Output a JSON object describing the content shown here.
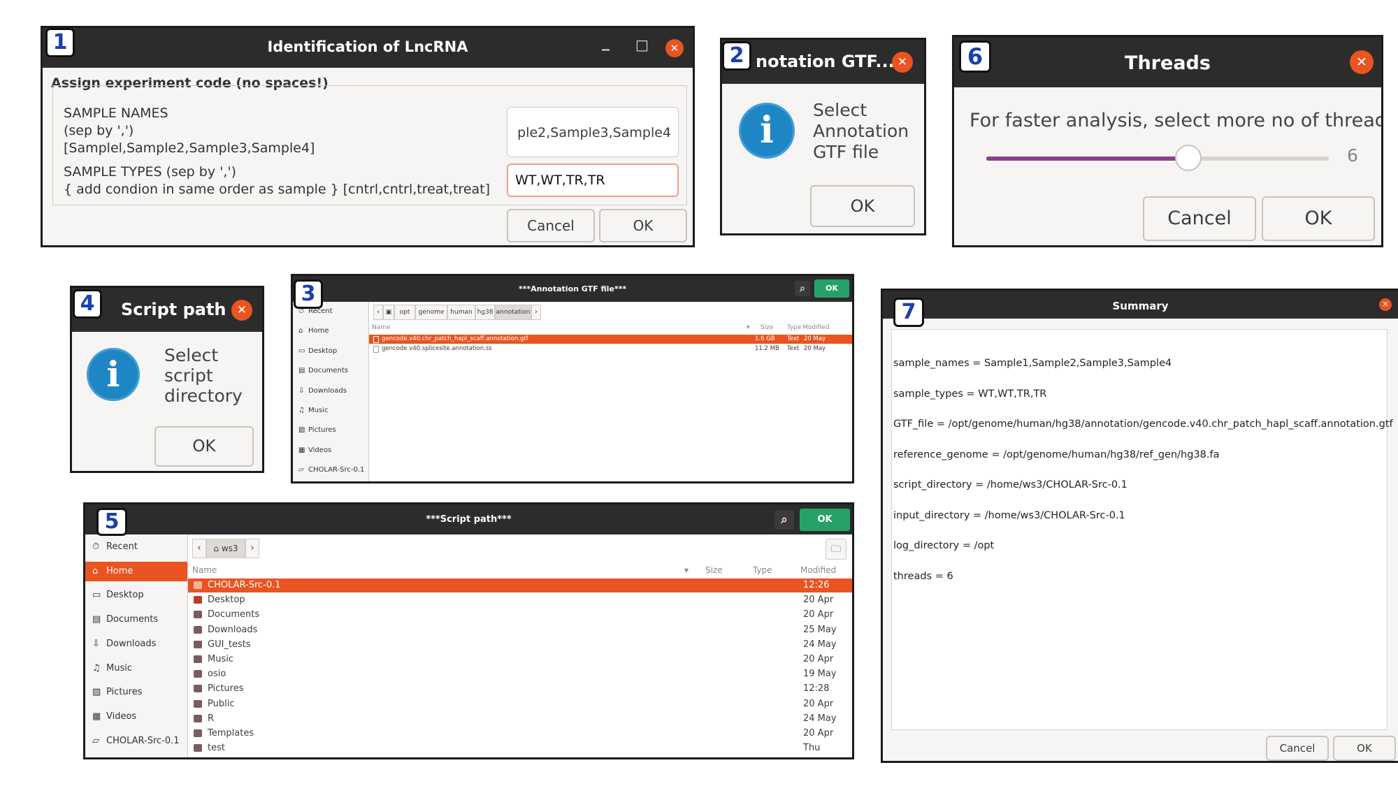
{
  "dialog1": {
    "number": "1",
    "title": "Identification of LncRNA",
    "minimize_icon": "minimize-icon",
    "maximize_icon": "maximize-icon",
    "close_icon": "close-icon",
    "close_glyph": "✕",
    "minimize_glyph": "_",
    "maximize_glyph": "□",
    "group_label": "Assign experiment code (no spaces!)",
    "names_label": [
      "SAMPLE NAMES",
      "(sep by ',')",
      "[Samplel,Sample2,Sample3,Sample4]"
    ],
    "names_value": "ple2,Sample3,Sample4",
    "types_label": [
      "SAMPLE TYPES (sep by ',')",
      "{ add condion in same order as sample } [cntrl,cntrl,treat,treat]"
    ],
    "types_value": "WT,WT,TR,TR",
    "cancel": "Cancel",
    "ok": "OK"
  },
  "dialog2": {
    "number": "2",
    "title": "notation GTF...",
    "close_glyph": "✕",
    "info_glyph": "i",
    "message": [
      "Select",
      "Annotation",
      "GTF file"
    ],
    "ok": "OK"
  },
  "dialog6": {
    "number": "6",
    "title": "Threads",
    "close_glyph": "✕",
    "message": "For faster analysis, select more no of threads",
    "slider_value": "6",
    "slider_fraction": 0.59,
    "cancel": "Cancel",
    "ok": "OK"
  },
  "dialog4": {
    "number": "4",
    "title": "Script path",
    "close_glyph": "✕",
    "info_glyph": "i",
    "message": [
      "Select",
      "script",
      "directory"
    ],
    "ok": "OK"
  },
  "dialog3": {
    "number": "3",
    "title": "***Annotation GTF file***",
    "ok": "OK",
    "search_glyph": "⌕",
    "sidebar": [
      {
        "label": "Recent",
        "icon": "clock-icon",
        "glyph": "⏱"
      },
      {
        "label": "Home",
        "icon": "home-icon",
        "glyph": "⌂"
      },
      {
        "label": "Desktop",
        "icon": "desktop-icon",
        "glyph": "▭"
      },
      {
        "label": "Documents",
        "icon": "document-icon",
        "glyph": "▤"
      },
      {
        "label": "Downloads",
        "icon": "download-icon",
        "glyph": "⇩"
      },
      {
        "label": "Music",
        "icon": "music-icon",
        "glyph": "♫"
      },
      {
        "label": "Pictures",
        "icon": "picture-icon",
        "glyph": "▨"
      },
      {
        "label": "Videos",
        "icon": "video-icon",
        "glyph": "▦"
      },
      {
        "label": "CHOLAR-Src-0.1",
        "icon": "folder-icon",
        "glyph": "▱"
      }
    ],
    "path": [
      "opt",
      "genome",
      "human",
      "hg38",
      "annotation"
    ],
    "columns": {
      "name": "Name",
      "size": "Size",
      "type": "Type",
      "modified": "Modified"
    },
    "files": [
      {
        "name": "gencode.v40.chr_patch_hapl_scaff.annotation.gtf",
        "size": "1.6 GB",
        "type": "Text",
        "modified": "20 May",
        "selected": true
      },
      {
        "name": "gencode.v40.splicesite.annotation.ss",
        "size": "11.2 MB",
        "type": "Text",
        "modified": "20 May",
        "selected": false
      }
    ]
  },
  "dialog5": {
    "number": "5",
    "title": "***Script path***",
    "ok": "OK",
    "search_glyph": "⌕",
    "newfolder_glyph": "🗀",
    "sidebar": [
      {
        "label": "Recent",
        "icon": "clock-icon",
        "glyph": "⏱"
      },
      {
        "label": "Home",
        "icon": "home-icon",
        "glyph": "⌂",
        "selected": true
      },
      {
        "label": "Desktop",
        "icon": "desktop-icon",
        "glyph": "▭"
      },
      {
        "label": "Documents",
        "icon": "document-icon",
        "glyph": "▤"
      },
      {
        "label": "Downloads",
        "icon": "download-icon",
        "glyph": "⇩"
      },
      {
        "label": "Music",
        "icon": "music-icon",
        "glyph": "♫"
      },
      {
        "label": "Pictures",
        "icon": "picture-icon",
        "glyph": "▨"
      },
      {
        "label": "Videos",
        "icon": "video-icon",
        "glyph": "▦"
      },
      {
        "label": "CHOLAR-Src-0.1",
        "icon": "folder-icon",
        "glyph": "▱"
      }
    ],
    "path": [
      "ws3"
    ],
    "columns": {
      "name": "Name",
      "size": "Size",
      "type": "Type",
      "modified": "Modified"
    },
    "files": [
      {
        "name": "CHOLAR-Src-0.1",
        "modified": "12:26",
        "selected": true
      },
      {
        "name": "Desktop",
        "modified": "20 Apr",
        "accent": "#c0392b"
      },
      {
        "name": "Documents",
        "modified": "20 Apr"
      },
      {
        "name": "Downloads",
        "modified": "25 May"
      },
      {
        "name": "GUI_tests",
        "modified": "24 May"
      },
      {
        "name": "Music",
        "modified": "20 Apr"
      },
      {
        "name": "osio",
        "modified": "19 May"
      },
      {
        "name": "Pictures",
        "modified": "12:28"
      },
      {
        "name": "Public",
        "modified": "20 Apr"
      },
      {
        "name": "R",
        "modified": "24 May"
      },
      {
        "name": "Templates",
        "modified": "20 Apr"
      },
      {
        "name": "test",
        "modified": "Thu"
      }
    ]
  },
  "dialog7": {
    "number": "7",
    "title": "Summary",
    "close_glyph": "✕",
    "lines": [
      "sample_names = Sample1,Sample2,Sample3,Sample4",
      "sample_types = WT,WT,TR,TR",
      "GTF_file = /opt/genome/human/hg38/annotation/gencode.v40.chr_patch_hapl_scaff.annotation.gtf",
      "reference_genome = /opt/genome/human/hg38/ref_gen/hg38.fa",
      "script_directory = /home/ws3/CHOLAR-Src-0.1",
      "input_directory = /home/ws3/CHOLAR-Src-0.1",
      "log_directory = /opt",
      "threads = 6"
    ],
    "cancel": "Cancel",
    "ok": "OK"
  },
  "colors": {
    "accent": "#e95420",
    "titlebar": "#2c2c2c",
    "ok_green": "#26a269",
    "number_blue": "#1a3fb0",
    "info_blue": "#1f86c6",
    "folder": "#7b5b5b"
  }
}
